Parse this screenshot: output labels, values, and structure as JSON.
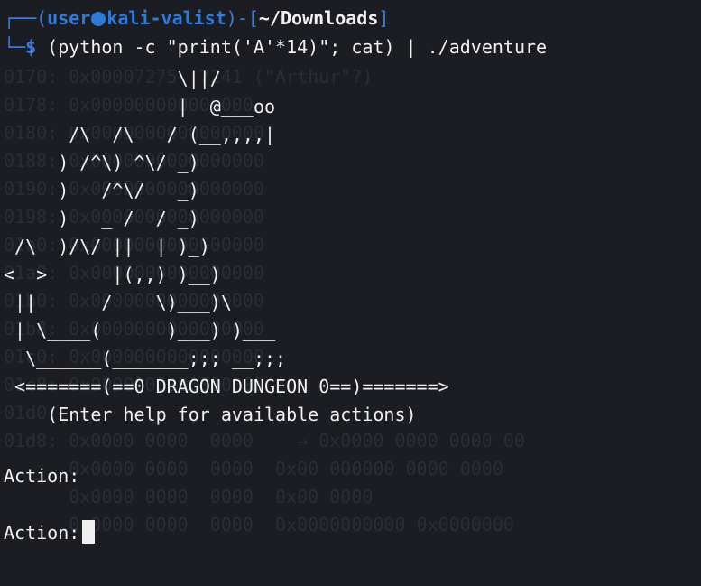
{
  "terminal": {
    "prompt": {
      "corner_top": "┌──(",
      "user_host": "user",
      "host": "kali-valist",
      "separator": ")-[",
      "cwd": "~/Downloads",
      "close": "]",
      "corner_bottom": "└─",
      "dollar": "$",
      "command": " (python -c \"print('A'*14)\"; cat) | ./adventure"
    },
    "background_text": "0170: 0x00007275  7241 (\"Arthur\"?)\n0178: 0x000000000000000\n0180: 0x0000000000000000\n0188: 0x0000000000000000\n0190: 0x0000000000000000\n0198: 0x0000000000000000\n01a0: 0x0000000000000000\n01a8: 0x0000000000000000\n01b0: 0x0000000000000000\n01b8: 0x0000000000000000\n01c0: 0x0000000000000000\n01c8: 0x0000000000000000\n01d0:\n01d8: 0x0000 0000  0000    → 0x0000 0000 0000 00\n      0x0000 0000  0000  0x00 000000 0000 0000\n      0x0000 0000  0000  0x00 0000\n      0x0000 0000  0000  0x0000000000 0x0000000",
    "ascii_art": "                \\||/\n                |  @___oo\n      /\\  /\\   / (__,,,,|\n     ) /^\\) ^\\/ _)\n     )   /^\\/   _)\n     )   _ /  / _)\n /\\  )/\\/ ||  | )_)\n<  >      |(,,) )__)\n ||      /    \\)___)\\\n | \\____(      )___) )___\n  \\______(_______;;; __;;;\n <=======(==0 DRAGON DUNGEON 0==)=======>\n    (Enter help for available actions)",
    "output_lines": [
      "Action:",
      "Action:"
    ]
  }
}
